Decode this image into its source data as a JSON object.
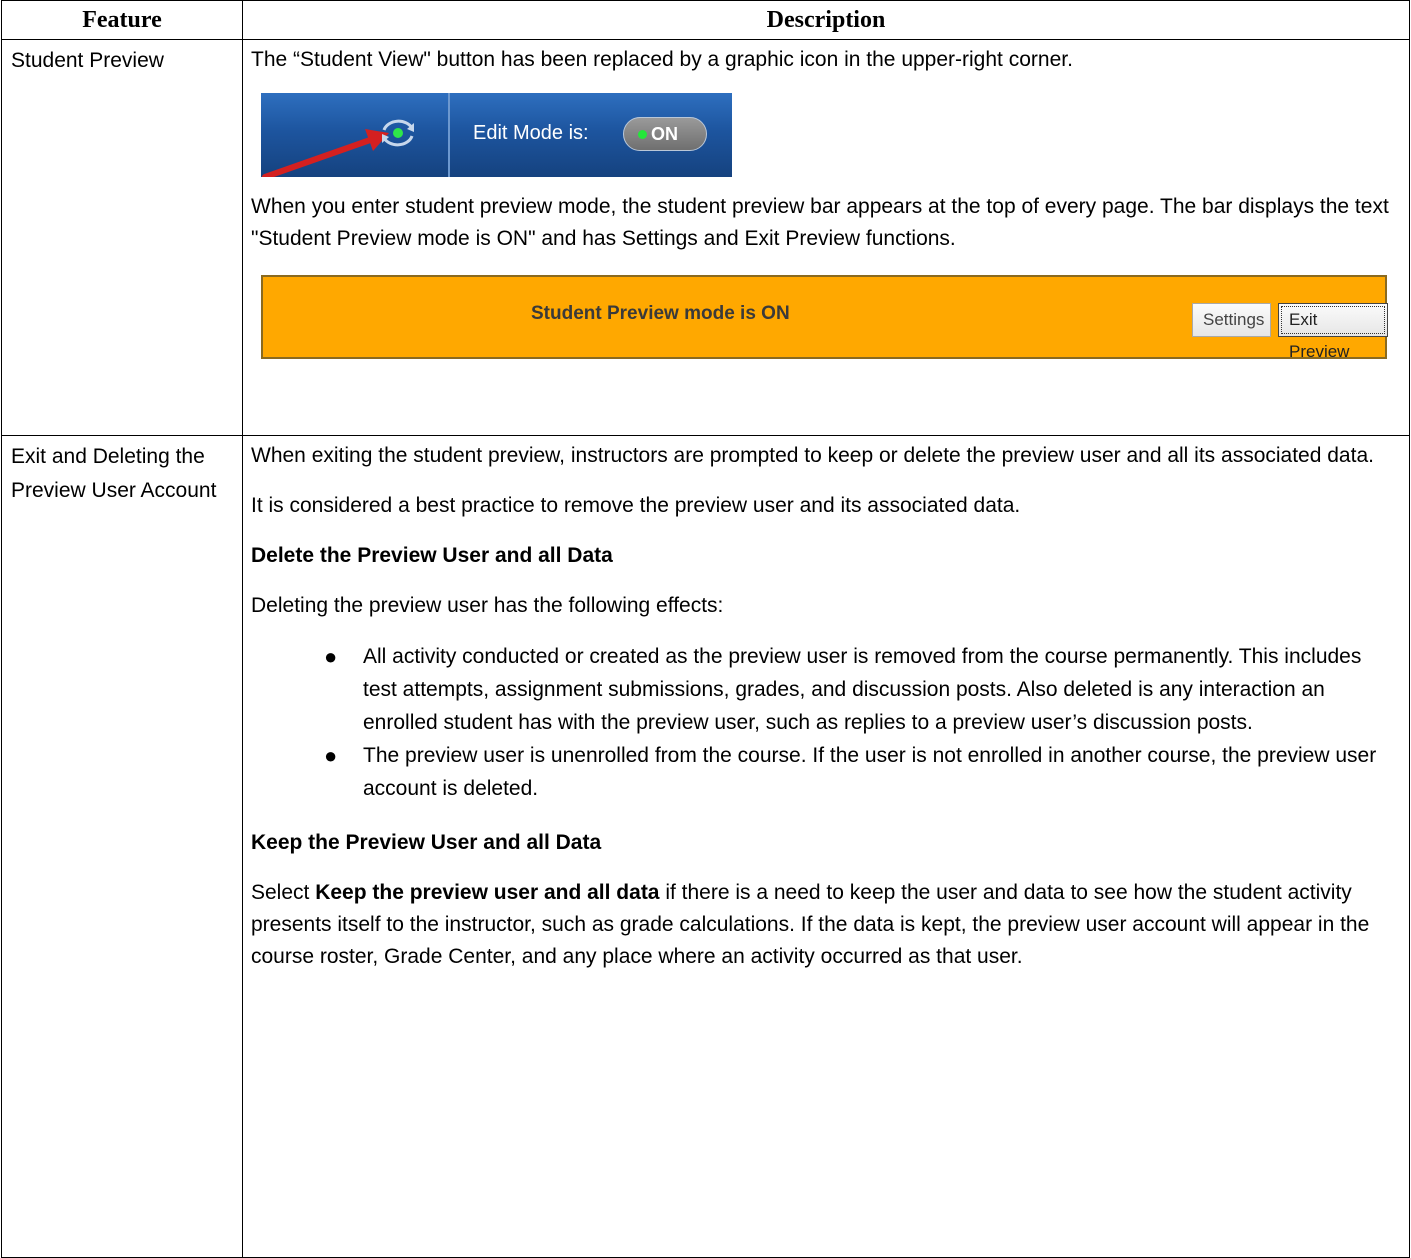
{
  "table": {
    "headers": {
      "feature": "Feature",
      "description": "Description"
    },
    "row1": {
      "feature": "Student Preview",
      "intro": "The “Student View\" button has been replaced by a graphic icon in the upper-right corner.",
      "edit_mode_label": "Edit Mode is:",
      "edit_mode_toggle": "ON",
      "paragraph": "When you enter student preview mode, the student preview bar appears at the top of every page. The bar displays the text \"Student Preview mode is ON\" and has Settings and Exit Preview functions.",
      "preview_bar": {
        "text": "Student Preview mode is ON",
        "settings_label": "Settings",
        "exit_label": "Exit Preview",
        "color": "#ffa800"
      }
    },
    "row2": {
      "feature": "Exit and Deleting the Preview User Account",
      "p1": "When exiting the student preview, instructors are prompted to keep or delete the preview user and all its associated data.",
      "p2": "It is considered a best practice to remove the preview user and its associated data.",
      "heading1": "Delete the Preview User and all Data",
      "p3": "Deleting the preview user has the following effects:",
      "bullets": [
        "All activity conducted or created as the preview user is removed from the course permanently. This includes test attempts, assignment submissions, grades, and discussion posts. Also deleted is any interaction an enrolled student has with the preview user, such as replies to a preview user’s discussion posts.",
        "The preview user is unenrolled from the course. If the user is not enrolled in another course, the preview user account is deleted."
      ],
      "heading2": "Keep the Preview User and all Data",
      "p4_prefix": "Select ",
      "p4_bold": "Keep the preview user and all data",
      "p4_suffix": " if there is a need to keep the user and data to see how the student activity presents itself to the instructor, such as grade calculations. If the data is kept, the preview user account will appear in the course roster, Grade Center, and any place where an activity occurred as that user."
    }
  }
}
